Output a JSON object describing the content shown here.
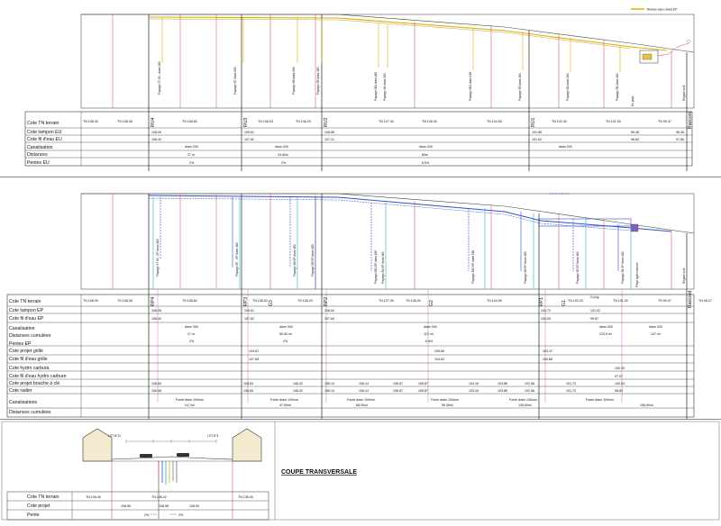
{
  "profile_eu": {
    "legend": "Réseau eaux usées EP",
    "rows": [
      "Cote TN terrain",
      "Cote tampon EU",
      "Cote fil d'eau EU",
      "Canalisation",
      "Distances",
      "Pentes EU"
    ],
    "chambers": [
      "RU4",
      "RU3",
      "RU2",
      "RU1",
      "Raccord"
    ],
    "tn_values": [
      "TN 108.00",
      "TN 108.38",
      "TN 108.82",
      "TN 108.53",
      "TN 108.29",
      "TN 107.00",
      "TN 106.00",
      "TN 104.50",
      "TN 102.00",
      "TN 101.00",
      "TN 99.47"
    ],
    "tampon": [
      "108.06",
      "109.61",
      "108.88",
      "102.88",
      "99.48",
      "96.45"
    ],
    "fil_eau": [
      "106.40",
      "107.82",
      "107.31",
      "101.62",
      "98.64",
      "97.86"
    ],
    "canalisation": [
      "diam 200",
      "diam 200",
      "diam 200",
      "diam 200"
    ],
    "distances": [
      "27 m",
      "23.60m",
      "80m"
    ],
    "pentes": [
      "2%",
      "2%",
      "6.5%"
    ],
    "vertical_labels": [
      "Piquage 97.00 - diam 160",
      "Piquage B7 diam 160",
      "Piquage B6 diam 160",
      "Piquage B5 diam 160",
      "Piquage B11 diam 160",
      "Piquage B4 diam 160",
      "Piquage B12 diam 160",
      "Piquage B3 diam 160",
      "Piquage B2 diam 160",
      "Piquage B1 diam 160",
      "Eu pays",
      "Regard sorti"
    ]
  },
  "profile_ep": {
    "rows": [
      "Cote TN terrain",
      "Cote tampon EP",
      "Cote fil d'eau EP",
      "Canalisation",
      "Distances cumulées",
      "Pentes EP",
      "Cote projet grille",
      "Cote fil d'eau grille",
      "Cote hydro carbura",
      "Cote fil d'eau hydro carbure",
      "Cote projet bouche à clé",
      "Cote radier",
      "Canalisations",
      "Distances cumulées"
    ],
    "chambers": [
      "RP4",
      "RP3",
      "G3",
      "RP2",
      "G2",
      "RP1",
      "G1",
      "Raccord"
    ],
    "tn_values": [
      "TN 108.00",
      "TN 108.38",
      "TN 108.82",
      "TN 108.53",
      "TN 108.29",
      "TN 107.00",
      "TN 106.00",
      "TN 104.50",
      "TN 102.00",
      "TN 101.00",
      "TN 99.47",
      "TN 98.27"
    ],
    "tampon": [
      "108.06",
      "109.61",
      "108.84",
      "103.73",
      "101.02"
    ],
    "fil_eau": [
      "106.40",
      "107.82",
      "107.84",
      "100.05",
      "99.87"
    ],
    "canalisation": [
      "diam 300",
      "diam 300",
      "diam 300",
      "diam 300",
      "diam 300"
    ],
    "distances": [
      "27 m",
      "50.50 ml",
      "112 ml",
      "123.5 ml",
      "137 ml"
    ],
    "pentes": [
      "2%",
      "2%",
      "6.5%"
    ],
    "grille": [
      "109.61",
      "105.66",
      "103.22"
    ],
    "fil_grille": [
      "107.65",
      "104.62",
      "100.68"
    ],
    "hydro": [
      "100.49"
    ],
    "fil_hydro": [
      "97.07"
    ],
    "bouche": [
      "108.63",
      "108.63",
      "108.32",
      "108.14",
      "106.14",
      "106.87",
      "106.87",
      "104.16",
      "103.86",
      "102.86",
      "101.72",
      "100.63"
    ],
    "radier": [
      "106.56",
      "108.56",
      "108.32",
      "108.14",
      "106.14",
      "106.87",
      "106.87",
      "103.16",
      "103.86",
      "102.86",
      "101.72",
      "98.83"
    ],
    "canalisations": [
      "Fonte diam 100mm",
      "Fonte diam 100mm",
      "Fonte diam 100mm",
      "Fonte diam 100mm",
      "Fonte diam 100mm",
      "Fonte diam 100mm"
    ],
    "dist_cumul": [
      "24.7ml",
      "47.90ml",
      "68.30ml",
      "99.30ml",
      "136.80ml",
      "156.50ml"
    ],
    "vertical_labels": [
      "Piquage 97.00 - EP diam 160",
      "Piquage B7 - EP diam 160",
      "Piquage B6 EP diam 160",
      "Piquage B5 EP diam 160",
      "Piquage B11 EP diam 160",
      "Piquage B4 EP diam 160",
      "Piquage B12 EP diam 160",
      "Piquage B3 EP diam 160",
      "Piquage B2 EP diam 160",
      "Piquage B1 EP diam 160",
      "Piège hydrocarbure"
    ],
    "g_label": "G plug",
    "raccord_label": "Regard sorti"
  },
  "cross_section": {
    "title": "COUPE TRANSVERSALE",
    "lot_left": "LOT N°11",
    "lot_right": "LOT N°4",
    "rows": [
      "Cote TN terrain",
      "Cote projet",
      "Pente"
    ],
    "tn_values": [
      "TN 108.40",
      "TN 108.42",
      "TN 108.40"
    ],
    "projet": [
      "108.56",
      "108.50"
    ],
    "projet_mid": [
      "108.58"
    ],
    "pentes": [
      "2%",
      "2%"
    ]
  }
}
